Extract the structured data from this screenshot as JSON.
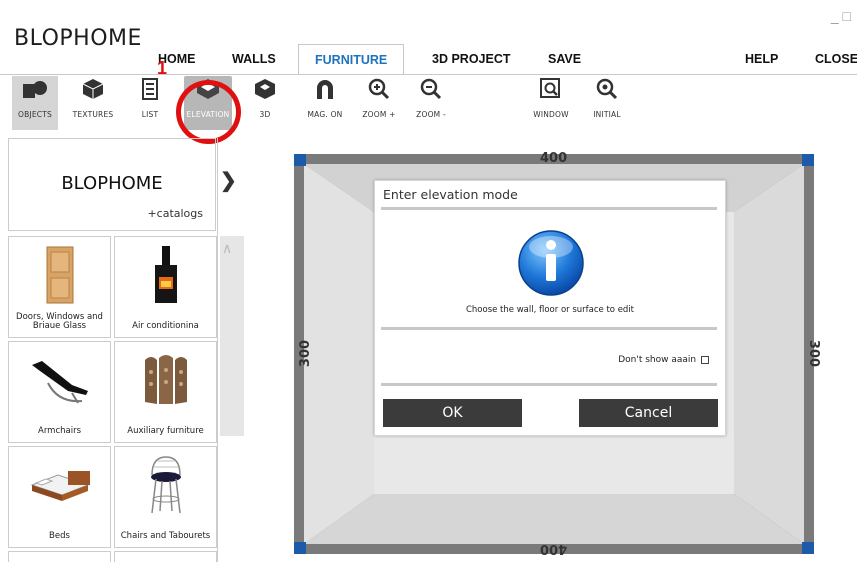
{
  "app": {
    "title": "BLOPHOME",
    "window_controls": "_ □"
  },
  "menu": {
    "home": "HOME",
    "walls": "WALLS",
    "furniture": "FURNITURE",
    "project3d": "3D PROJECT",
    "save": "SAVE",
    "help": "HELP",
    "close": "CLOSE"
  },
  "toolbar": {
    "objects": "OBJECTS",
    "textures": "TEXTURES",
    "list": "LIST",
    "elevation": "ELEVATION",
    "view3d": "3D",
    "mag_on": "MAG. ON",
    "zoom_in": "ZOOM +",
    "zoom_out": "ZOOM -",
    "window": "WINDOW",
    "initial": "INITIAL"
  },
  "annotation": {
    "step_number": "1"
  },
  "left_panel": {
    "brand": "BLOPHOME",
    "catalogs": "+catalogs",
    "categories": [
      {
        "name": "Doors, Windows and Briaue Glass"
      },
      {
        "name": "Air conditionina"
      },
      {
        "name": "Armchairs"
      },
      {
        "name": "Auxiliary furniture"
      },
      {
        "name": "Beds"
      },
      {
        "name": "Chairs and Tabourets"
      }
    ]
  },
  "room": {
    "top_dim": "400",
    "bottom_dim": "400",
    "left_dim": "300",
    "right_dim": "300"
  },
  "dialog": {
    "title": "Enter elevation mode",
    "message": "Choose the wall, floor or surface to edit",
    "dont_show": "Don't show aaain",
    "ok": "OK",
    "cancel": "Cancel"
  }
}
